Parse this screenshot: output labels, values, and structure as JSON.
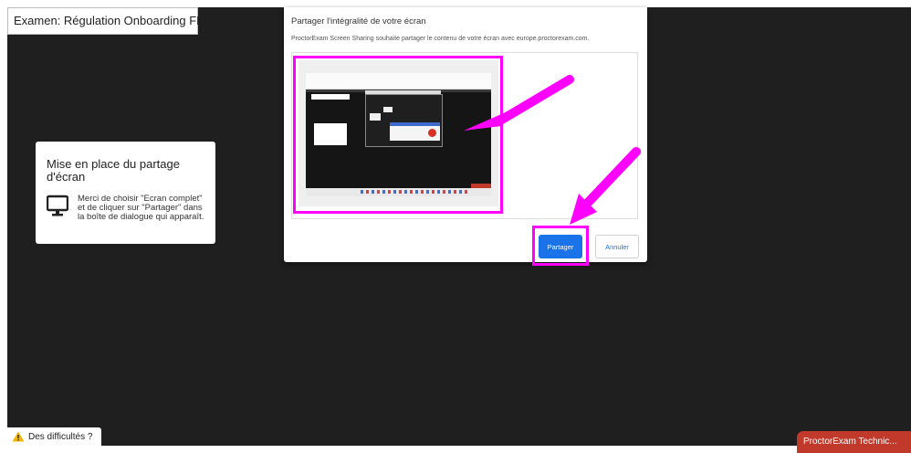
{
  "exam": {
    "title": "Examen: Régulation Onboarding FR"
  },
  "setup": {
    "heading": "Mise en place du partage d'écran",
    "instruction": "Merci de choisir \"Ecran complet\" et de cliquer sur \"Partager\" dans la boîte de dialogue qui apparaît.",
    "icon": "monitor-icon"
  },
  "dialog": {
    "title": "Partager l'intégralité de votre écran",
    "subtitle": "ProctorExam Screen Sharing souhaite partager le contenu de votre écran avec europe.proctorexam.com.",
    "share_label": "Partager",
    "cancel_label": "Annuler"
  },
  "footer": {
    "help_label": "Des difficultés ?",
    "tech_label": "ProctorExam Technic..."
  },
  "colors": {
    "highlight": "#ff00ff",
    "primary": "#1a73e8",
    "tech": "#c0392b",
    "background": "#1f1f1f"
  }
}
